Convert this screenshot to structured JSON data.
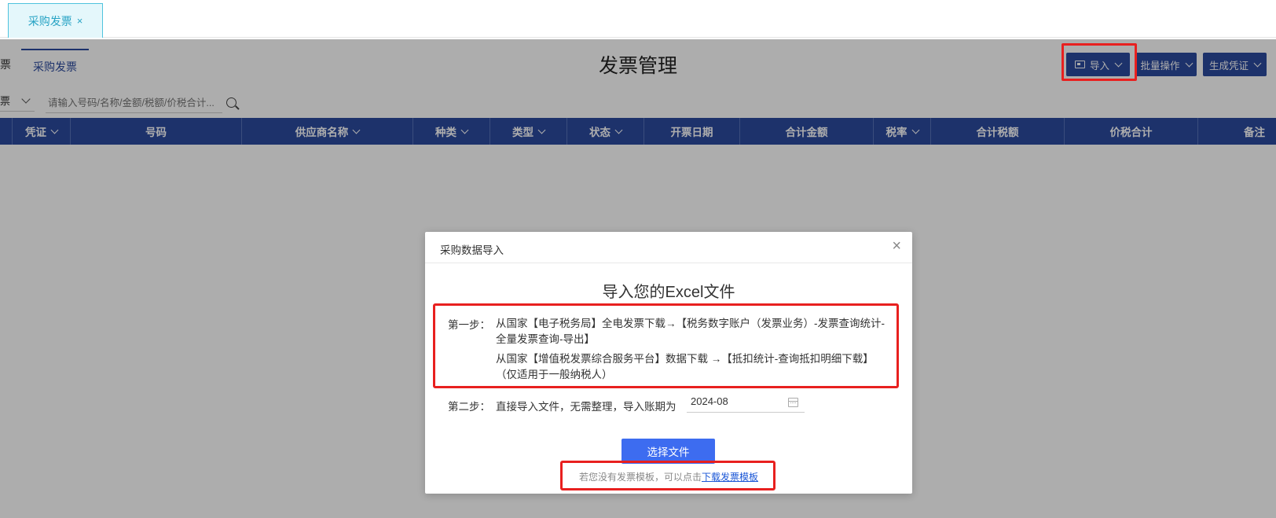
{
  "top_tabs": [
    {
      "label": "采购发票",
      "close": "×"
    }
  ],
  "header": {
    "sub_tab_cut": "票",
    "sub_tab": "采购发票",
    "title": "发票管理",
    "buttons": {
      "import": "导入",
      "batch": "批量操作",
      "voucher": "生成凭证"
    }
  },
  "filter": {
    "select_value": "票",
    "search_placeholder": "请输入号码/名称/金额/税额/价税合计..."
  },
  "table": {
    "columns": [
      "凭证",
      "号码",
      "供应商名称",
      "种类",
      "类型",
      "状态",
      "开票日期",
      "合计金额",
      "税率",
      "合计税额",
      "价税合计",
      "备注"
    ]
  },
  "modal": {
    "title": "采购数据导入",
    "close": "×",
    "heading": "导入您的Excel文件",
    "step1_label": "第一步：",
    "step1_line1": "从国家【电子税务局】全电发票下载→【税务数字账户（发票业务）-发票查询统计-全量发票查询-导出】",
    "step1_line2": "从国家【增值税发票综合服务平台】数据下载 →【抵扣统计-查询抵扣明细下载】（仅适用于一般纳税人）",
    "step2_label": "第二步：",
    "step2_text": "直接导入文件，无需整理，导入账期为",
    "period": "2024-08",
    "choose_button": "选择文件",
    "hint_prefix": "若您没有发票模板，可以点击",
    "hint_link": "下载发票模板"
  },
  "colors": {
    "primary": "#2c4a9e",
    "button_blue": "#3d6cf0",
    "highlight_red": "#e8201f",
    "tab_cyan": "#4fc3dd"
  }
}
